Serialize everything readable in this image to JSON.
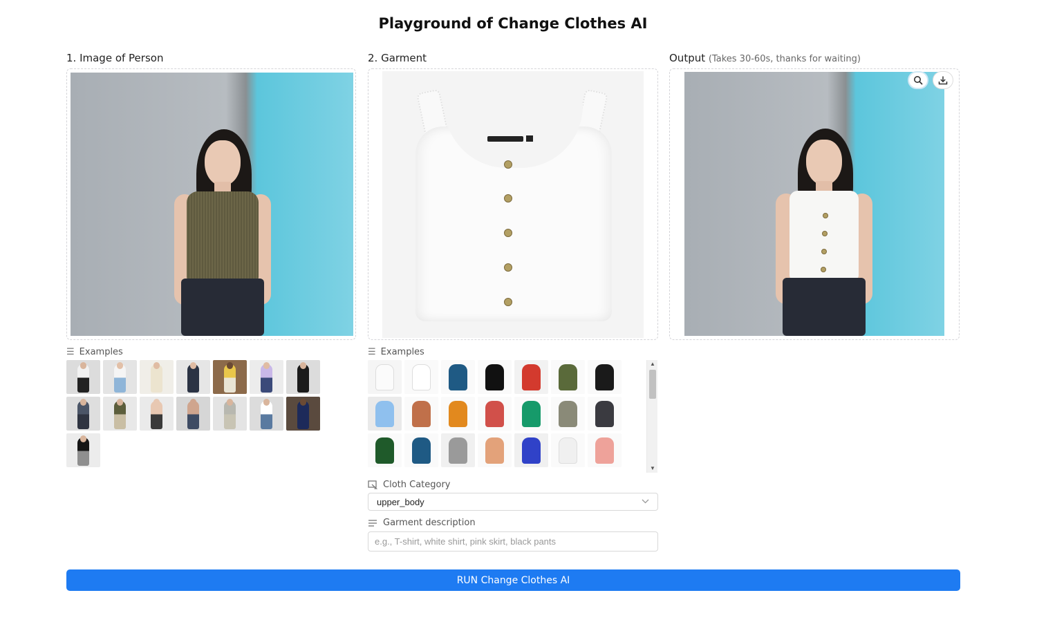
{
  "title": "Playground of Change Clothes AI",
  "person": {
    "label": "1. Image of Person"
  },
  "garment": {
    "label": "2. Garment"
  },
  "output": {
    "label": "Output",
    "note": "(Takes 30-60s, thanks for waiting)"
  },
  "examples_label": "Examples",
  "person_examples": [
    {
      "top": "#f2f2f2",
      "bottom": "#222",
      "bg": "#dcdcdc",
      "skin": "#d9b59c"
    },
    {
      "top": "#f5f5f5",
      "bottom": "#8fb5d8",
      "bg": "#e4e4e4",
      "skin": "#e2c0a8"
    },
    {
      "top": "#ece4cf",
      "bottom": "#ece4cf",
      "bg": "#f0eee8",
      "skin": "#e0bca3"
    },
    {
      "top": "#2b3344",
      "bottom": "#2b3344",
      "bg": "#e6e6e6",
      "skin": "#e0bca3"
    },
    {
      "top": "#e9c64a",
      "bottom": "#e9e4d4",
      "bg": "#8c6a4a",
      "skin": "#6b4a34"
    },
    {
      "top": "#c9b8e8",
      "bottom": "#3b4a7a",
      "bg": "#ececec",
      "skin": "#e0bca3"
    },
    {
      "top": "#1b1b1b",
      "bottom": "#1b1b1b",
      "bg": "#dcdcdc",
      "skin": "#d9b59c"
    },
    {
      "top": "#4b5567",
      "bottom": "#2f3441",
      "bg": "#dedede",
      "skin": "#d9b59c"
    },
    {
      "top": "#5c5e3c",
      "bottom": "#c9bea4",
      "bg": "#e8e8e8",
      "skin": "#d9b59c"
    },
    {
      "top": "#e8c8b2",
      "bottom": "#3a3a3a",
      "bg": "#eaeaea",
      "skin": "#e8c8b2"
    },
    {
      "top": "#cfa58e",
      "bottom": "#3e4b63",
      "bg": "#d6d6d6",
      "skin": "#cfa58e"
    },
    {
      "top": "#b8b8b0",
      "bottom": "#c8c4b4",
      "bg": "#e4e4e4",
      "skin": "#d9b59c"
    },
    {
      "top": "#ffffff",
      "bottom": "#5a7aa0",
      "bg": "#dcdcdc",
      "skin": "#d9b59c"
    },
    {
      "top": "#1d2a5a",
      "bottom": "#1d2a5a",
      "bg": "#5a4a3e",
      "skin": "#6b4a34"
    },
    {
      "top": "#151515",
      "bottom": "#8f8f8f",
      "bg": "#ececec",
      "skin": "#d9b59c"
    }
  ],
  "garment_examples": [
    {
      "color": "#fbfbfb",
      "bg": "#f5f5f5"
    },
    {
      "color": "#ffffff",
      "bg": "#fafafa"
    },
    {
      "color": "#1f5a84",
      "bg": "#fafafa"
    },
    {
      "color": "#111111",
      "bg": "#fafafa"
    },
    {
      "color": "#d33a2e",
      "bg": "#f2f2f2"
    },
    {
      "color": "#5a6a3a",
      "bg": "#fafafa"
    },
    {
      "color": "#1a1a1a",
      "bg": "#fafafa"
    },
    {
      "color": "#8fc0ee",
      "bg": "#eaeaea"
    },
    {
      "color": "#c0704a",
      "bg": "#fafafa"
    },
    {
      "color": "#e2891e",
      "bg": "#fafafa"
    },
    {
      "color": "#d1504a",
      "bg": "#fafafa"
    },
    {
      "color": "#169a6a",
      "bg": "#fafafa"
    },
    {
      "color": "#8a8a78",
      "bg": "#fafafa"
    },
    {
      "color": "#3a3a40",
      "bg": "#fafafa"
    },
    {
      "color": "#1f5a2a",
      "bg": "#fafafa"
    },
    {
      "color": "#1f5a84",
      "bg": "#fafafa"
    },
    {
      "color": "#9a9a9a",
      "bg": "#f0f0f0"
    },
    {
      "color": "#e3a27a",
      "bg": "#fafafa"
    },
    {
      "color": "#3042c8",
      "bg": "#f0f0f0"
    },
    {
      "color": "#f0f0f0",
      "bg": "#fafafa"
    },
    {
      "color": "#eea29a",
      "bg": "#fafafa"
    }
  ],
  "cloth_category": {
    "label": "Cloth Category",
    "value": "upper_body"
  },
  "garment_description": {
    "label": "Garment description",
    "placeholder": "e.g., T-shirt, white shirt, pink skirt, black pants",
    "value": ""
  },
  "run_button": "RUN Change Clothes AI",
  "icons": {
    "zoom": "magnifier-icon",
    "download": "download-icon",
    "examples": "list-icon",
    "category": "image-select-icon",
    "description": "text-lines-icon",
    "dropdown": "chevron-down-icon"
  },
  "colors": {
    "primary_button": "#1e7bf2",
    "wall_blue": "#7fd2e4"
  }
}
